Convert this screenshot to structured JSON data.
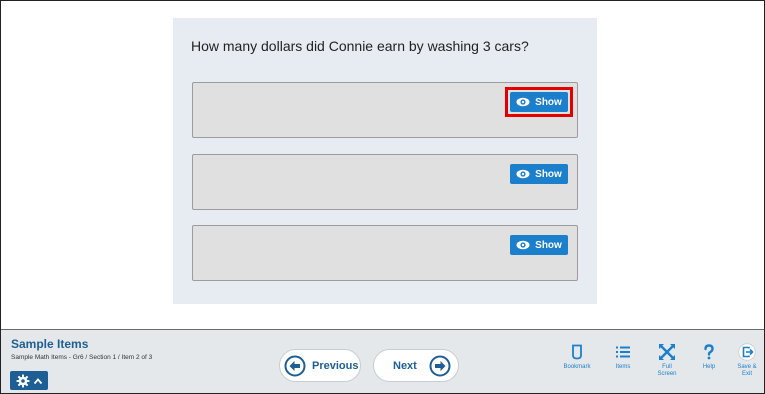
{
  "question": {
    "text": "How many dollars did Connie earn by washing 3 cars?"
  },
  "responses": [
    {
      "show_label": "Show",
      "highlighted": true
    },
    {
      "show_label": "Show",
      "highlighted": false
    },
    {
      "show_label": "Show",
      "highlighted": false
    }
  ],
  "footer": {
    "title": "Sample Items",
    "subtitle": "Sample Math Items - Gr6 / Section 1 / Item 2 of 3",
    "previous_label": "Previous",
    "next_label": "Next",
    "tools": {
      "bookmark": "Bookmark",
      "items": "Items",
      "fullscreen_line1": "Full",
      "fullscreen_line2": "Screen",
      "help": "Help",
      "save_line1": "Save &",
      "save_line2": "Exit"
    }
  },
  "colors": {
    "accent": "#1b7fcc",
    "brand_dark": "#1d5e95",
    "highlight": "#e00000"
  },
  "icons": [
    "eye-icon",
    "gear-icon",
    "chevron-up-icon",
    "arrow-left-circle-icon",
    "arrow-right-circle-icon",
    "bookmark-icon",
    "list-icon",
    "fullscreen-icon",
    "help-icon",
    "exit-icon"
  ]
}
